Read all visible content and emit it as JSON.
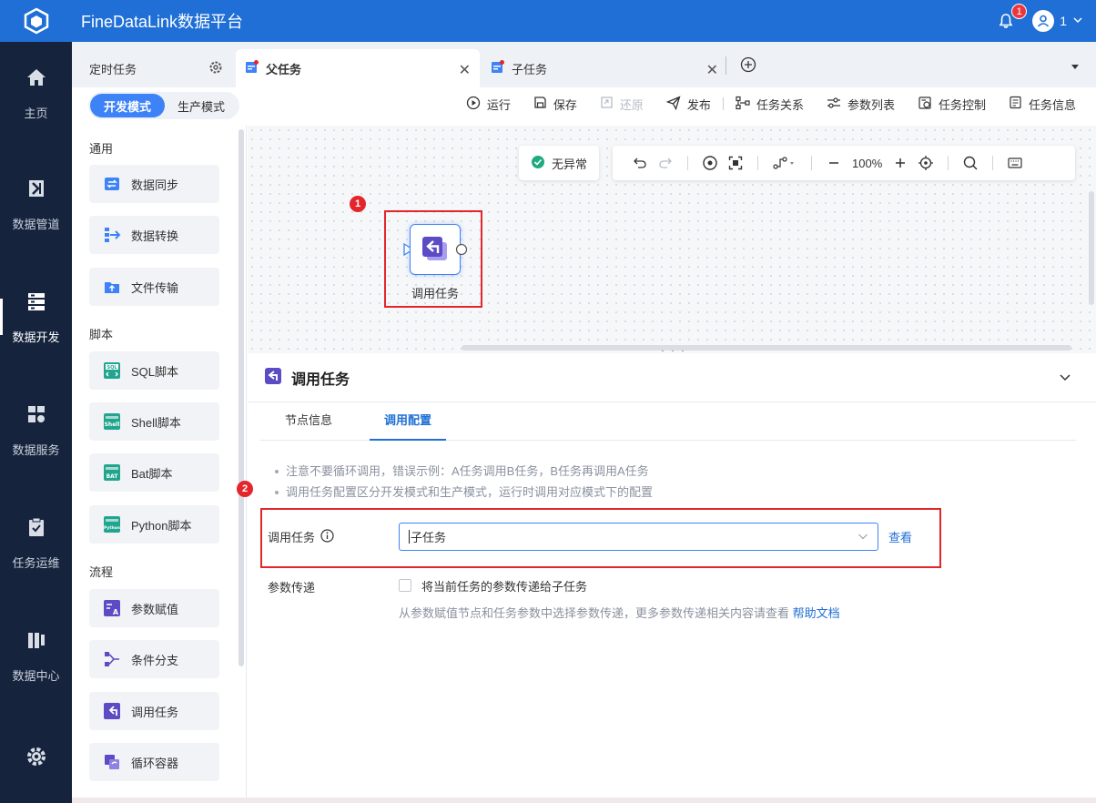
{
  "app": {
    "title": "FineDataLink数据平台"
  },
  "header": {
    "notification_count": "1",
    "user_name": "1"
  },
  "nav": [
    {
      "label": "主页",
      "icon": "home-icon"
    },
    {
      "label": "数据管道",
      "icon": "pipeline-icon"
    },
    {
      "label": "数据开发",
      "icon": "dev-icon"
    },
    {
      "label": "数据服务",
      "icon": "service-icon"
    },
    {
      "label": "任务运维",
      "icon": "ops-icon"
    },
    {
      "label": "数据中心",
      "icon": "datacenter-icon"
    }
  ],
  "tabs": {
    "scheduled": "定时任务",
    "parent": "父任务",
    "child": "子任务"
  },
  "mode": {
    "dev": "开发模式",
    "prod": "生产模式"
  },
  "toolbar": {
    "run": "运行",
    "save": "保存",
    "restore": "还原",
    "publish": "发布",
    "relation": "任务关系",
    "params": "参数列表",
    "control": "任务控制",
    "info": "任务信息"
  },
  "node_panel": {
    "sections": {
      "common": "通用",
      "script": "脚本",
      "flow": "流程"
    },
    "items": [
      {
        "label": "数据同步"
      },
      {
        "label": "数据转换"
      },
      {
        "label": "文件传输"
      },
      {
        "label": "SQL脚本"
      },
      {
        "label": "Shell脚本"
      },
      {
        "label": "Bat脚本"
      },
      {
        "label": "Python脚本"
      },
      {
        "label": "参数赋值"
      },
      {
        "label": "条件分支"
      },
      {
        "label": "调用任务"
      },
      {
        "label": "循环容器"
      }
    ]
  },
  "canvas": {
    "status": "无异常",
    "zoom": "100%",
    "node_label": "调用任务",
    "step1": "1"
  },
  "detail": {
    "title": "调用任务",
    "tab_node_info": "节点信息",
    "tab_call_config": "调用配置",
    "note1": "注意不要循环调用，错误示例：A任务调用B任务，B任务再调用A任务",
    "note2": "调用任务配置区分开发模式和生产模式，运行时调用对应模式下的配置",
    "step2": "2",
    "call_task_label": "调用任务",
    "call_task_value": "子任务",
    "view_link": "查看",
    "param_label": "参数传递",
    "param_checkbox": "将当前任务的参数传递给子任务",
    "param_hint": "从参数赋值节点和任务参数中选择参数传递，更多参数传递相关内容请查看",
    "help_link": "帮助文档"
  },
  "colors": {
    "brand": "#1f6fd6",
    "nav_bg": "#15233c",
    "highlight": "#e3262b",
    "accent": "#3e82f7"
  }
}
